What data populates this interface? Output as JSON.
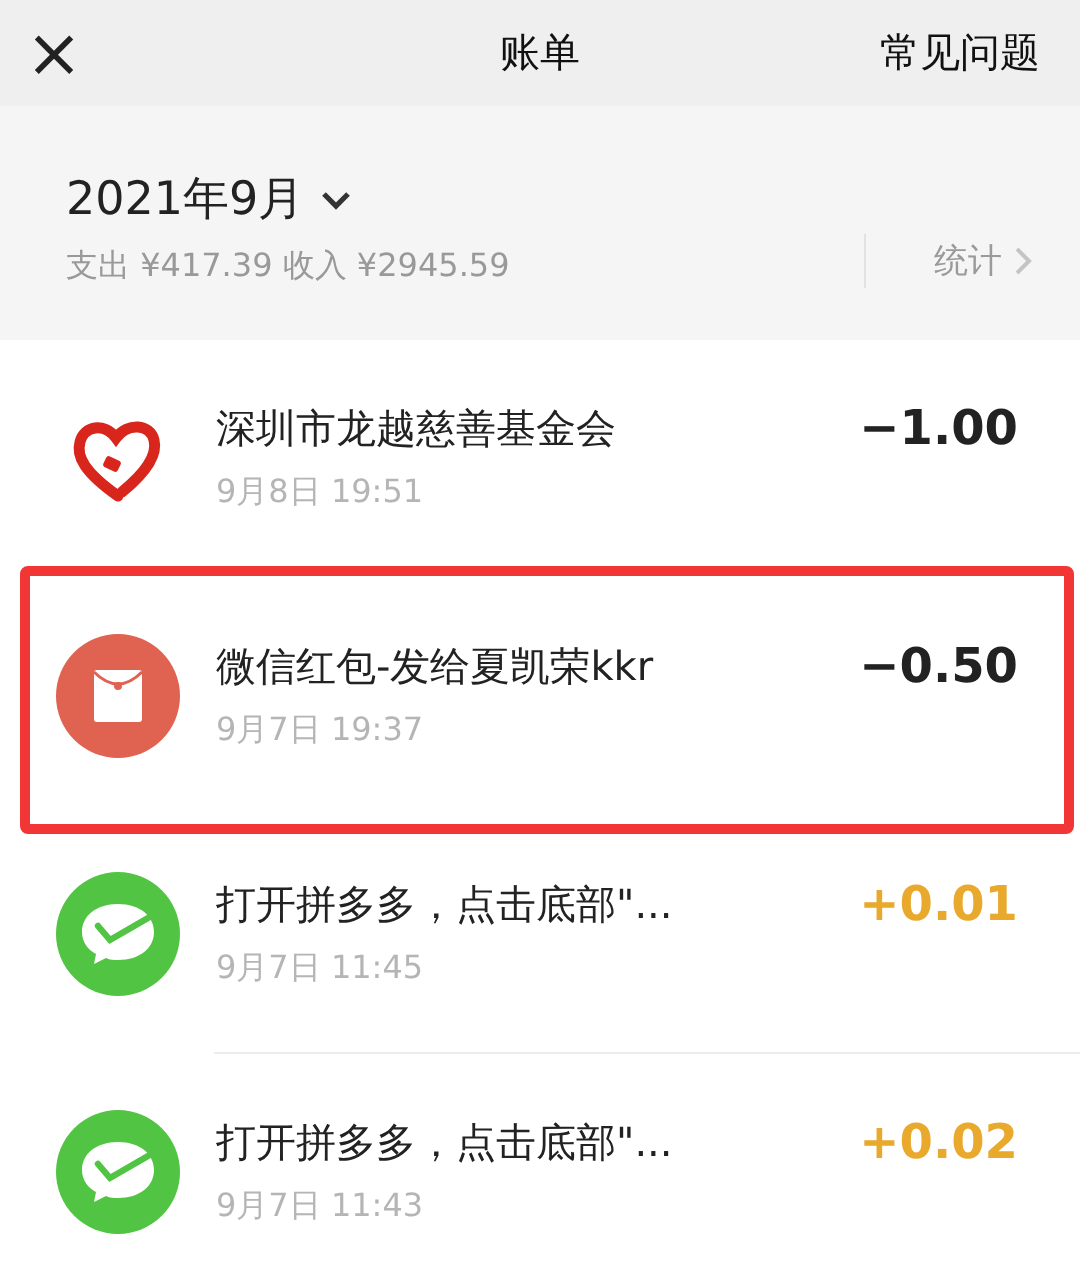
{
  "header": {
    "close": "×",
    "title": "账单",
    "help": "常见问题"
  },
  "summary": {
    "month": "2021年9月",
    "totals": "支出 ¥417.39 收入 ¥2945.59",
    "stats": "统计"
  },
  "transactions": [
    {
      "kind": "charity",
      "name": "深圳市龙越慈善基金会",
      "time": "9月8日 19:51",
      "amount": "−1.00",
      "income": false,
      "highlighted": false
    },
    {
      "kind": "red-packet",
      "name": "微信红包-发给夏凯荣kkr",
      "time": "9月7日 19:37",
      "amount": "−0.50",
      "income": false,
      "highlighted": true
    },
    {
      "kind": "wechat-pay",
      "name": "打开拼多多，点击底部\"...",
      "time": "9月7日 11:45",
      "amount": "+0.01",
      "income": true,
      "highlighted": false
    },
    {
      "kind": "wechat-pay",
      "name": "打开拼多多，点击底部\"...",
      "time": "9月7日 11:43",
      "amount": "+0.02",
      "income": true,
      "highlighted": false
    }
  ]
}
